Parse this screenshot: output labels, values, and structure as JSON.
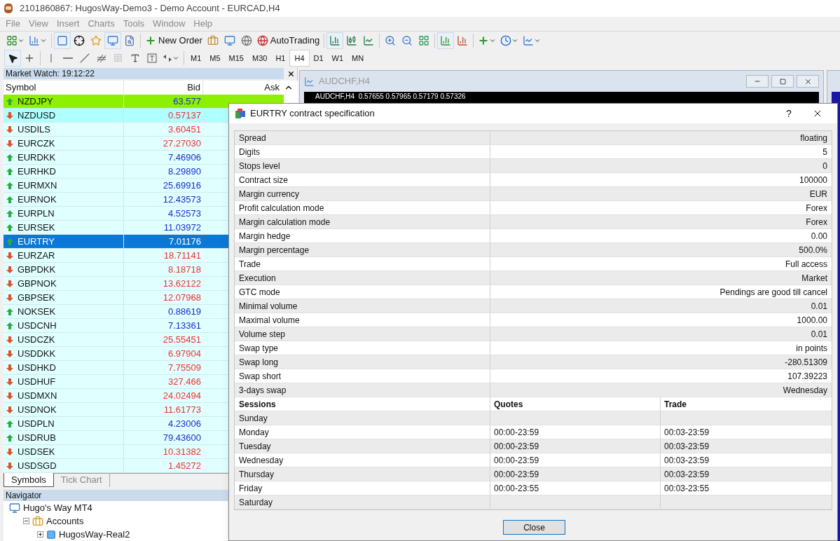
{
  "window": {
    "title": "2101860867: HugosWay-Demo3 - Demo Account - EURCAD,H4"
  },
  "menu": [
    {
      "label": "File",
      "disabled": true
    },
    {
      "label": "View",
      "disabled": true
    },
    {
      "label": "Insert",
      "disabled": true
    },
    {
      "label": "Charts",
      "disabled": true
    },
    {
      "label": "Tools",
      "disabled": true
    },
    {
      "label": "Window",
      "disabled": true
    },
    {
      "label": "Help",
      "disabled": true
    }
  ],
  "toolbar": {
    "new_order": "New Order",
    "auto_trading": "AutoTrading"
  },
  "timeframes": [
    {
      "label": "M1",
      "selected": false
    },
    {
      "label": "M5",
      "selected": false
    },
    {
      "label": "M15",
      "selected": false
    },
    {
      "label": "M30",
      "selected": false
    },
    {
      "label": "H1",
      "selected": false
    },
    {
      "label": "H4",
      "selected": true
    },
    {
      "label": "D1",
      "selected": false
    },
    {
      "label": "W1",
      "selected": false
    },
    {
      "label": "MN",
      "selected": false
    }
  ],
  "market_watch": {
    "title": "Market Watch: 19:12:22",
    "columns": [
      "Symbol",
      "Bid",
      "Ask"
    ],
    "rows": [
      {
        "symbol": "NZDJPY",
        "bid": "63.577",
        "rising": true,
        "color": "#8cf000",
        "selected": false
      },
      {
        "symbol": "NZDUSD",
        "bid": "0.57137",
        "rising": false,
        "color": "#b0ffff",
        "selected": false
      },
      {
        "symbol": "USDILS",
        "bid": "3.60451",
        "rising": false,
        "selected": false
      },
      {
        "symbol": "EURCZK",
        "bid": "27.27030",
        "rising": false,
        "selected": false
      },
      {
        "symbol": "EURDKK",
        "bid": "7.46906",
        "rising": true,
        "selected": false
      },
      {
        "symbol": "EURHKD",
        "bid": "8.29890",
        "rising": true,
        "selected": false
      },
      {
        "symbol": "EURMXN",
        "bid": "25.69916",
        "rising": true,
        "selected": false
      },
      {
        "symbol": "EURNOK",
        "bid": "12.43573",
        "rising": true,
        "selected": false
      },
      {
        "symbol": "EURPLN",
        "bid": "4.52573",
        "rising": true,
        "selected": false
      },
      {
        "symbol": "EURSEK",
        "bid": "11.03972",
        "rising": true,
        "selected": false
      },
      {
        "symbol": "EURTRY",
        "bid": "7.01176",
        "rising": true,
        "selected": true
      },
      {
        "symbol": "EURZAR",
        "bid": "18.71141",
        "rising": false,
        "selected": false
      },
      {
        "symbol": "GBPDKK",
        "bid": "8.18718",
        "rising": false,
        "selected": false
      },
      {
        "symbol": "GBPNOK",
        "bid": "13.62122",
        "rising": false,
        "selected": false
      },
      {
        "symbol": "GBPSEK",
        "bid": "12.07968",
        "rising": false,
        "selected": false
      },
      {
        "symbol": "NOKSEK",
        "bid": "0.88619",
        "rising": true,
        "selected": false
      },
      {
        "symbol": "USDCNH",
        "bid": "7.13361",
        "rising": true,
        "selected": false
      },
      {
        "symbol": "USDCZK",
        "bid": "25.55451",
        "rising": false,
        "selected": false
      },
      {
        "symbol": "USDDKK",
        "bid": "6.97904",
        "rising": false,
        "selected": false
      },
      {
        "symbol": "USDHKD",
        "bid": "7.75509",
        "rising": false,
        "selected": false
      },
      {
        "symbol": "USDHUF",
        "bid": "327.466",
        "rising": false,
        "selected": false
      },
      {
        "symbol": "USDMXN",
        "bid": "24.02494",
        "rising": false,
        "selected": false
      },
      {
        "symbol": "USDNOK",
        "bid": "11.61773",
        "rising": false,
        "selected": false
      },
      {
        "symbol": "USDPLN",
        "bid": "4.23006",
        "rising": true,
        "selected": false
      },
      {
        "symbol": "USDRUB",
        "bid": "79.43600",
        "rising": true,
        "selected": false
      },
      {
        "symbol": "USDSEK",
        "bid": "10.31382",
        "rising": false,
        "selected": false
      },
      {
        "symbol": "USDSGD",
        "bid": "1.45272",
        "rising": false,
        "selected": false
      }
    ],
    "tabs": [
      {
        "label": "Symbols",
        "selected": true
      },
      {
        "label": "Tick Chart",
        "selected": false
      }
    ]
  },
  "navigator": {
    "title": "Navigator",
    "tree": [
      {
        "label": "Hugo's Way MT4",
        "children": [
          {
            "label": "Accounts",
            "expanded": true,
            "children": [
              {
                "label": "HugosWay-Real2",
                "expanded": false
              }
            ]
          }
        ]
      }
    ]
  },
  "chart_window": {
    "title": "AUDCHF,H4",
    "header": "AUDCHF,H4  0.57655 0.57965 0.57179 0.57326"
  },
  "dialog": {
    "title": "EURTRY contract specification",
    "help": "?",
    "properties": [
      {
        "name": "Spread",
        "value": "floating"
      },
      {
        "name": "Digits",
        "value": "5"
      },
      {
        "name": "Stops level",
        "value": "0"
      },
      {
        "name": "Contract size",
        "value": "100000"
      },
      {
        "name": "Margin currency",
        "value": "EUR"
      },
      {
        "name": "Profit calculation mode",
        "value": "Forex"
      },
      {
        "name": "Margin calculation mode",
        "value": "Forex"
      },
      {
        "name": "Margin hedge",
        "value": "0.00"
      },
      {
        "name": "Margin percentage",
        "value": "500.0%"
      },
      {
        "name": "Trade",
        "value": "Full access"
      },
      {
        "name": "Execution",
        "value": "Market"
      },
      {
        "name": "GTC mode",
        "value": "Pendings are good till cancel"
      },
      {
        "name": "Minimal volume",
        "value": "0.01"
      },
      {
        "name": "Maximal volume",
        "value": "1000.00"
      },
      {
        "name": "Volume step",
        "value": "0.01"
      },
      {
        "name": "Swap type",
        "value": "in points"
      },
      {
        "name": "Swap long",
        "value": "-280.51309"
      },
      {
        "name": "Swap short",
        "value": "107.39223"
      },
      {
        "name": "3-days swap",
        "value": "Wednesday"
      }
    ],
    "sessions": {
      "columns": [
        "Sessions",
        "Quotes",
        "Trade"
      ],
      "rows": [
        {
          "day": "Sunday"
        },
        {
          "day": "Monday",
          "quotes": "00:00-23:59",
          "trade": "00:03-23:59"
        },
        {
          "day": "Tuesday",
          "quotes": "00:00-23:59",
          "trade": "00:03-23:59"
        },
        {
          "day": "Wednesday",
          "quotes": "00:00-23:59",
          "trade": "00:03-23:59"
        },
        {
          "day": "Thursday",
          "quotes": "00:00-23:59",
          "trade": "00:03-23:59"
        },
        {
          "day": "Friday",
          "quotes": "00:00-23:55",
          "trade": "00:03-23:55"
        },
        {
          "day": "Saturday"
        }
      ]
    },
    "close_button": "Close"
  }
}
